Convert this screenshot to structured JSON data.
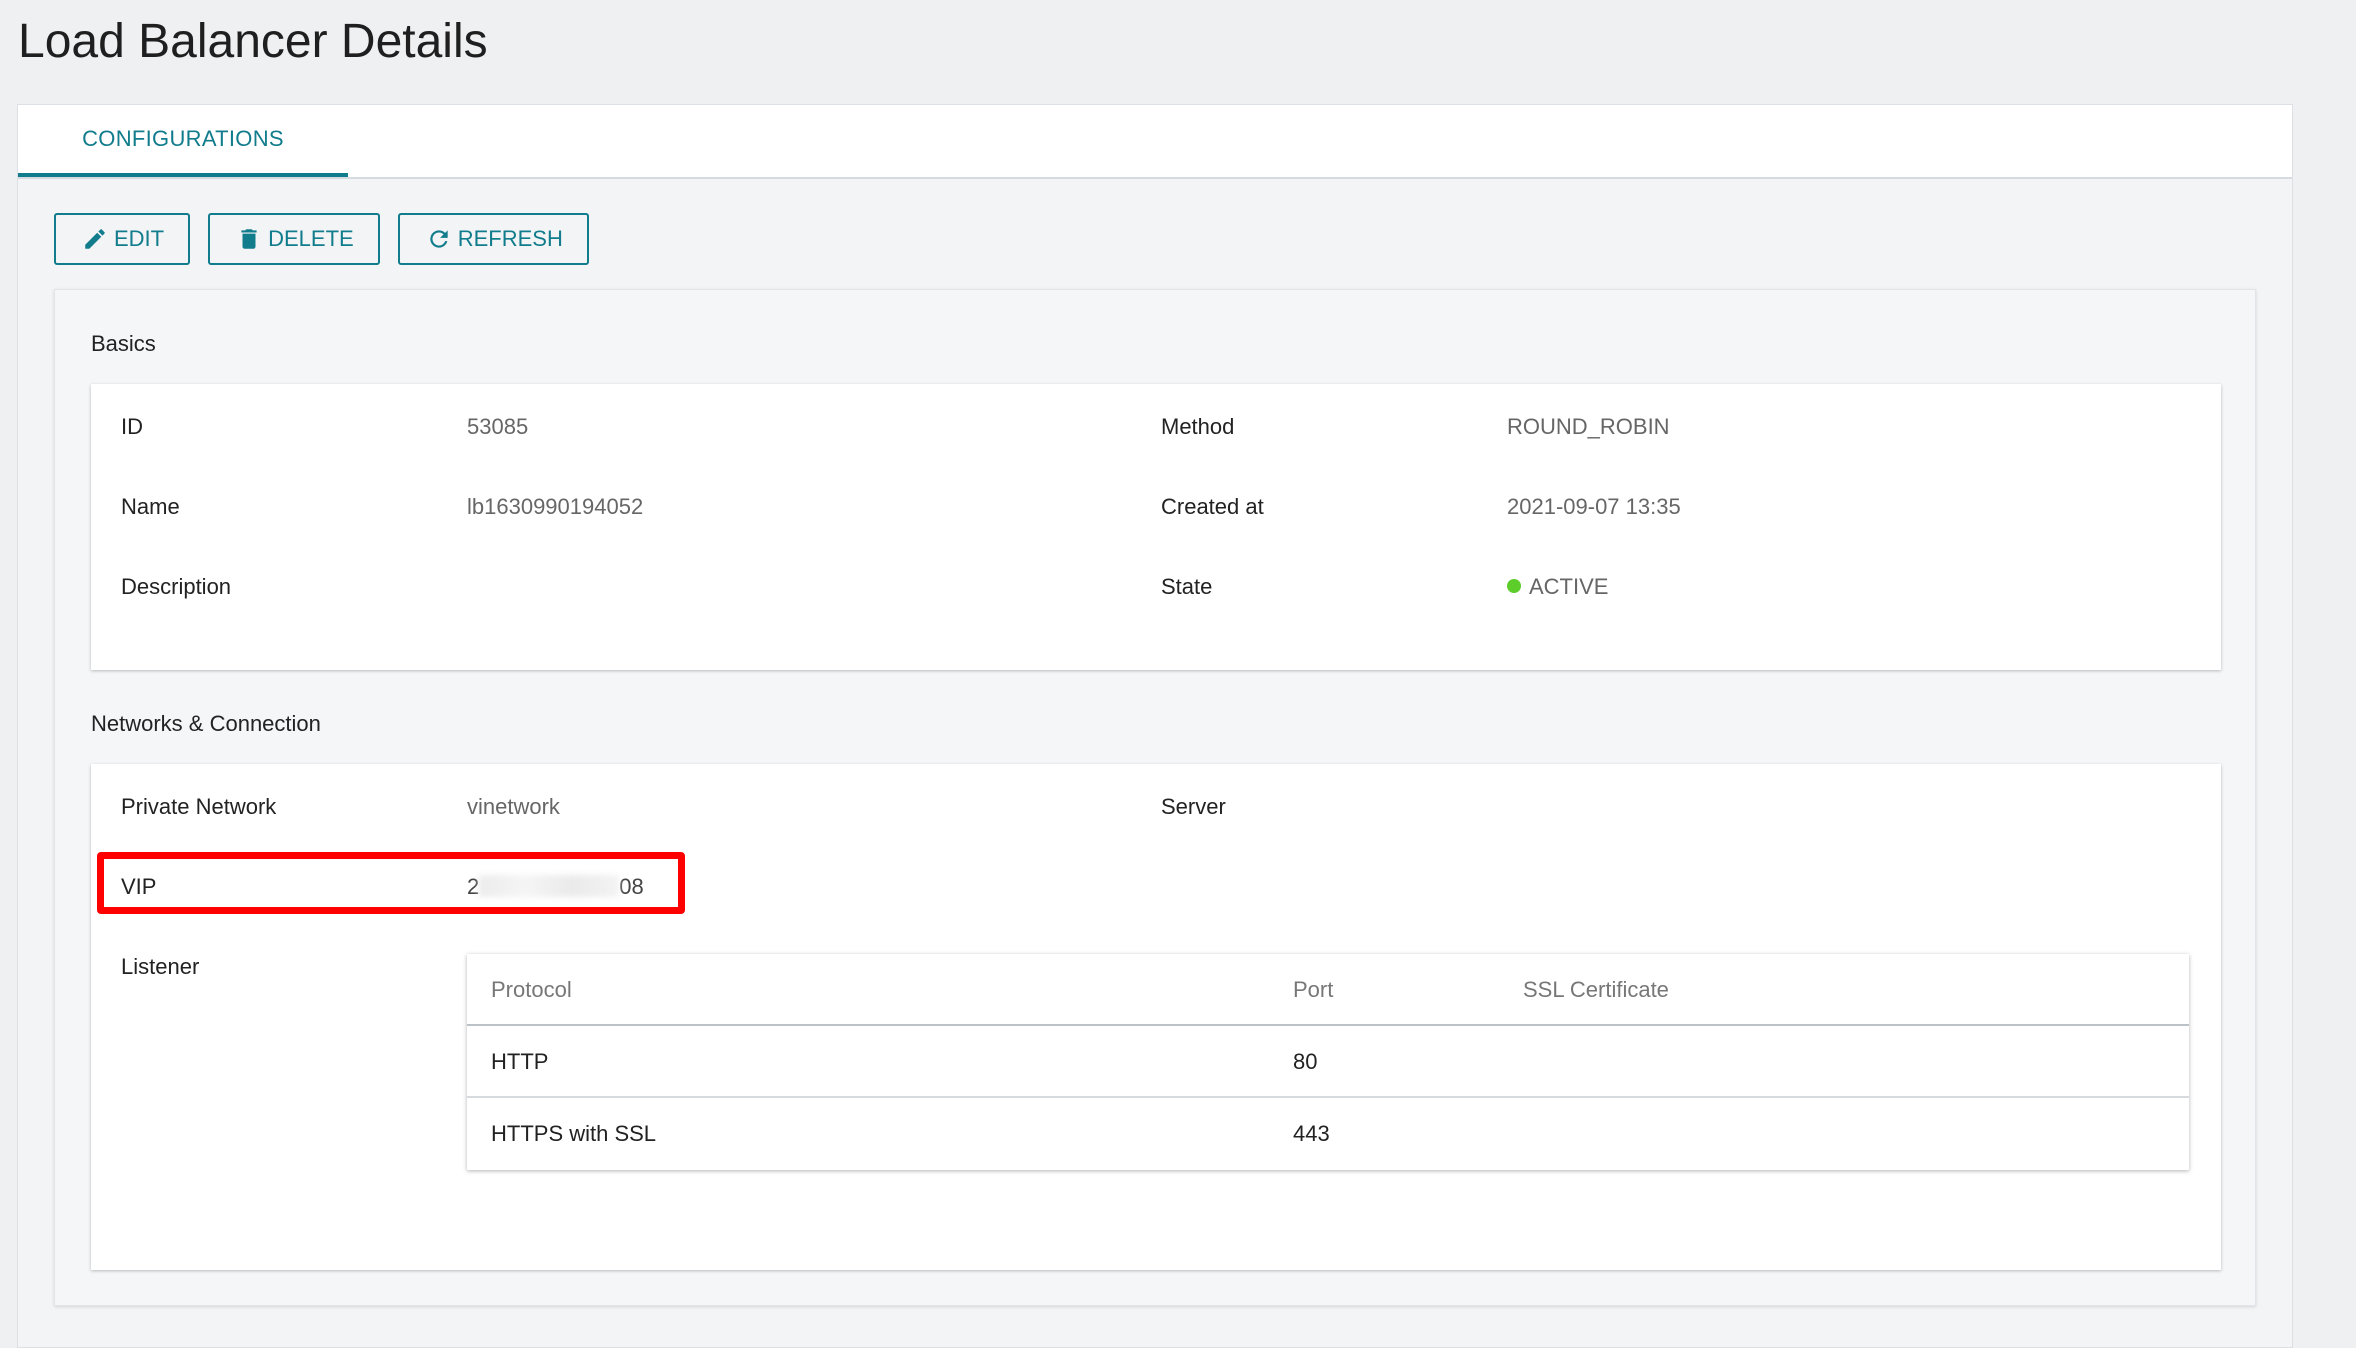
{
  "page": {
    "title": "Load Balancer Details"
  },
  "tabs": [
    {
      "label": "CONFIGURATIONS"
    }
  ],
  "toolbar": {
    "edit_label": "EDIT",
    "delete_label": "DELETE",
    "refresh_label": "REFRESH"
  },
  "basics": {
    "title": "Basics",
    "id_label": "ID",
    "id_value": "53085",
    "name_label": "Name",
    "name_value": "lb1630990194052",
    "description_label": "Description",
    "description_value": "",
    "method_label": "Method",
    "method_value": "ROUND_ROBIN",
    "created_label": "Created at",
    "created_value": "2021-09-07 13:35",
    "state_label": "State",
    "state_value": "ACTIVE",
    "state_color": "#5ccd2a"
  },
  "network": {
    "title": "Networks & Connection",
    "private_network_label": "Private Network",
    "private_network_value": "vinetwork",
    "server_label": "Server",
    "vip_label": "VIP",
    "vip_value_start": "2",
    "vip_value_end": "08",
    "listener_label": "Listener",
    "listener_table": {
      "headers": [
        "Protocol",
        "Port",
        "SSL Certificate"
      ],
      "rows": [
        {
          "protocol": "HTTP",
          "port": "80",
          "ssl": ""
        },
        {
          "protocol": "HTTPS with SSL",
          "port": "443",
          "ssl": ""
        }
      ]
    }
  },
  "colors": {
    "accent": "#117c8c",
    "highlight": "#ff0000"
  }
}
